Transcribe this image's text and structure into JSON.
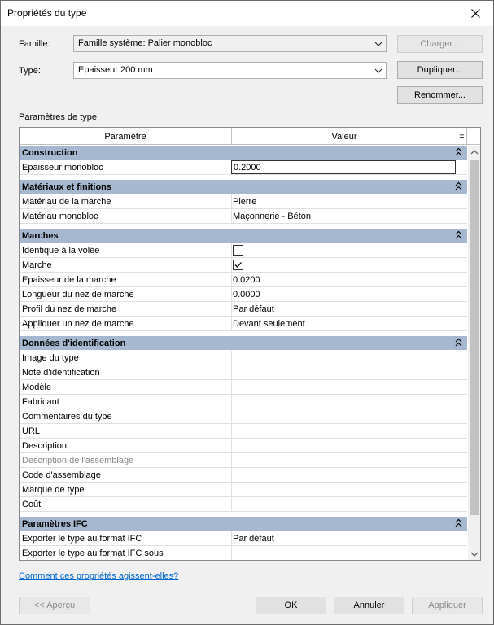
{
  "window": {
    "title": "Propriétés du type"
  },
  "famille": {
    "label": "Famille:",
    "value": "Famille système: Palier monobloc"
  },
  "type": {
    "label": "Type:",
    "value": "Epaisseur 200 mm"
  },
  "buttons": {
    "charger": "Charger...",
    "dupliquer": "Dupliquer...",
    "renommer": "Renommer...",
    "apercu": "<< Aperçu",
    "ok": "OK",
    "annuler": "Annuler",
    "appliquer": "Appliquer"
  },
  "section_label": "Paramètres de type",
  "table": {
    "col_param": "Paramètre",
    "col_value": "Valeur",
    "col_eq": "="
  },
  "groups": [
    {
      "name": "Construction",
      "rows": [
        {
          "param": "Epaisseur monobloc",
          "value": "0.2000"
        }
      ]
    },
    {
      "name": "Matériaux et finitions",
      "rows": [
        {
          "param": "Matériau de la marche",
          "value": "Pierre"
        },
        {
          "param": "Matériau monobloc",
          "value": "Maçonnerie - Béton"
        }
      ]
    },
    {
      "name": "Marches",
      "rows": [
        {
          "param": "Identique à la volée",
          "value": ""
        },
        {
          "param": "Marche",
          "value": ""
        },
        {
          "param": "Epaisseur de la marche",
          "value": "0.0200"
        },
        {
          "param": "Longueur du nez de marche",
          "value": "0.0000"
        },
        {
          "param": "Profil du nez de marche",
          "value": "Par défaut"
        },
        {
          "param": "Appliquer un nez de marche",
          "value": "Devant seulement"
        }
      ]
    },
    {
      "name": "Données d'identification",
      "rows": [
        {
          "param": "Image du type",
          "value": ""
        },
        {
          "param": "Note d'identification",
          "value": ""
        },
        {
          "param": "Modèle",
          "value": ""
        },
        {
          "param": "Fabricant",
          "value": ""
        },
        {
          "param": "Commentaires du type",
          "value": ""
        },
        {
          "param": "URL",
          "value": ""
        },
        {
          "param": "Description",
          "value": ""
        },
        {
          "param": "Description de l'assemblage",
          "value": ""
        },
        {
          "param": "Code d'assemblage",
          "value": ""
        },
        {
          "param": "Marque de type",
          "value": ""
        },
        {
          "param": "Coût",
          "value": ""
        }
      ]
    },
    {
      "name": "Paramètres IFC",
      "rows": [
        {
          "param": "Exporter le type au format IFC",
          "value": "Par défaut"
        },
        {
          "param": "Exporter le type au format IFC sous",
          "value": ""
        }
      ]
    }
  ],
  "link": "Comment ces propriétés agissent-elles?"
}
